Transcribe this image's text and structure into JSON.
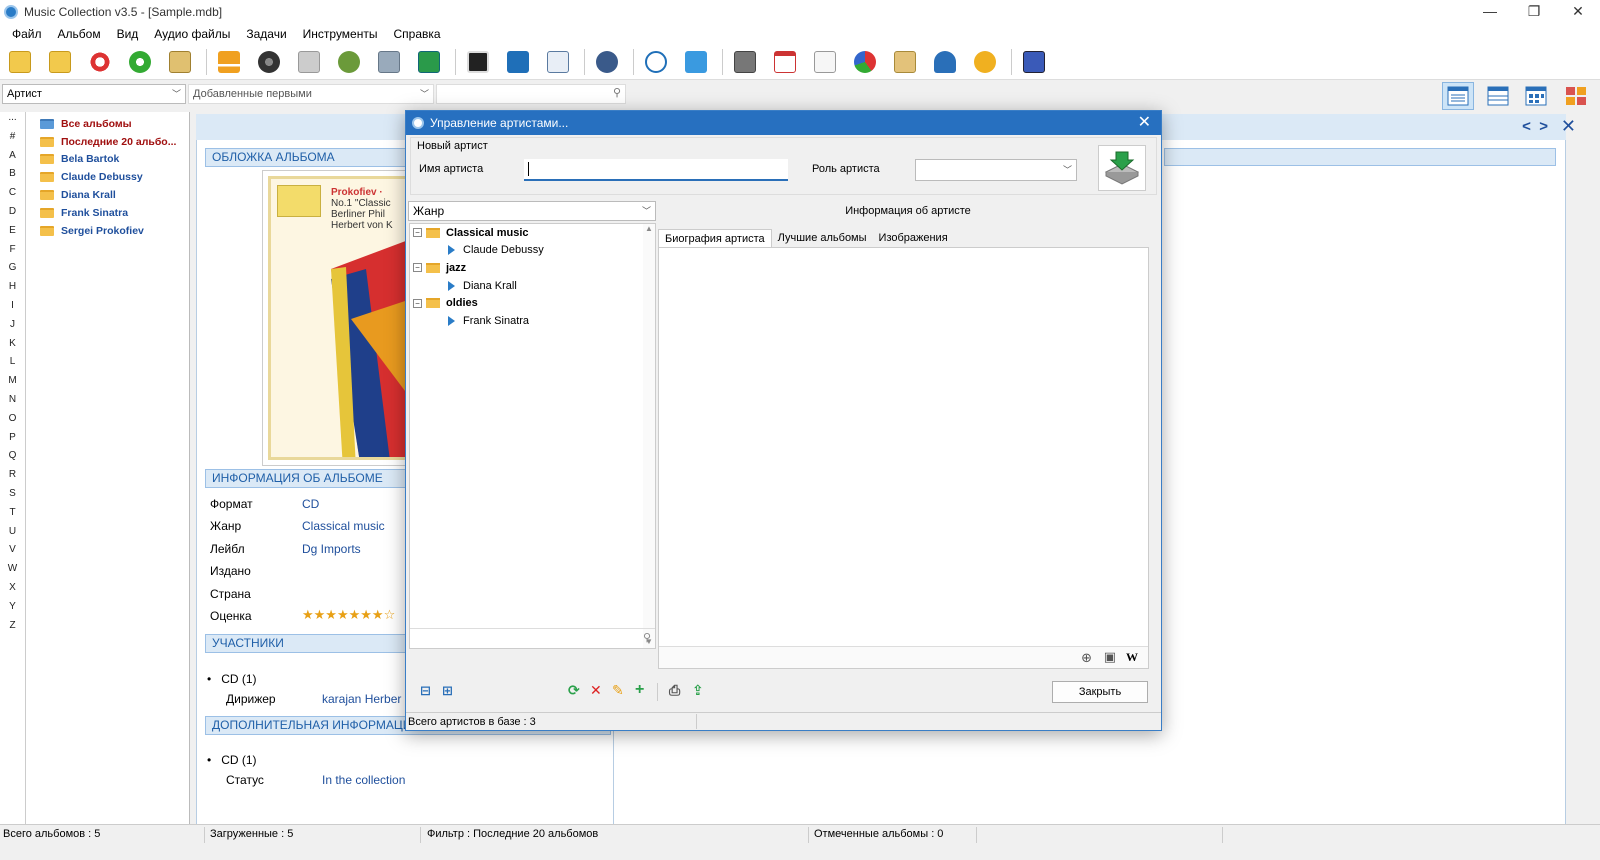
{
  "window": {
    "title": "Music Collection v3.5 - [Sample.mdb]",
    "minimize": "—",
    "restore": "❐",
    "close": "✕"
  },
  "menu": [
    "Файл",
    "Альбом",
    "Вид",
    "Аудио файлы",
    "Задачи",
    "Инструменты",
    "Справка"
  ],
  "filter": {
    "group_by": "Артист",
    "sort_by": "Добавленные первыми",
    "search_value": ""
  },
  "alphabet": [
    "...",
    "#",
    "A",
    "B",
    "C",
    "D",
    "E",
    "F",
    "G",
    "H",
    "I",
    "J",
    "K",
    "L",
    "M",
    "N",
    "O",
    "P",
    "Q",
    "R",
    "S",
    "T",
    "U",
    "V",
    "W",
    "X",
    "Y",
    "Z"
  ],
  "tree": {
    "items": [
      {
        "label": "Все альбомы"
      },
      {
        "label": "Последние 20 альбо..."
      },
      {
        "label": "Bela Bartok"
      },
      {
        "label": "Claude Debussy"
      },
      {
        "label": "Diana Krall"
      },
      {
        "label": "Frank Sinatra"
      },
      {
        "label": "Sergei Prokofiev"
      }
    ]
  },
  "album": {
    "cover_heading": "ОБЛОЖКА АЛЬБОМА",
    "cover_text_title": "Prokofiev ·",
    "cover_text_lines": [
      "No.1 \"Classic",
      "Berliner Phil",
      "Herbert von K"
    ],
    "info_heading": "ИНФОРМАЦИЯ ОБ АЛЬБОМЕ",
    "info": [
      {
        "label": "Формат",
        "value": "CD"
      },
      {
        "label": "Жанр",
        "value": "Classical music"
      },
      {
        "label": "Лейбл",
        "value": "Dg Imports"
      },
      {
        "label": "Издано",
        "value": ""
      },
      {
        "label": "Страна",
        "value": ""
      },
      {
        "label": "Оценка",
        "value": "★★★★★★★☆"
      }
    ],
    "participants_heading": "УЧАСТНИКИ",
    "participants_group": "CD (1)",
    "participants_role": "Дирижер",
    "participants_name": "karajan Herber",
    "extra_heading": "ДОПОЛНИТЕЛЬНАЯ ИНФОРМАЦИЯ",
    "extra_group": "CD (1)",
    "extra_label": "Статус",
    "extra_value": "In the collection"
  },
  "dialog": {
    "title": "Управление артистами...",
    "new_artist_label": "Новый артист",
    "artist_name_label": "Имя артиста",
    "artist_name_value": "",
    "artist_role_label": "Роль артиста",
    "artist_role_value": "",
    "genre_combo": "Жанр",
    "info_title": "Информация об артисте",
    "tabs": [
      "Биография артиста",
      "Лучшие альбомы",
      "Изображения"
    ],
    "genres": [
      {
        "name": "Classical music",
        "artists": [
          "Claude Debussy"
        ]
      },
      {
        "name": "jazz",
        "artists": [
          "Diana Krall"
        ]
      },
      {
        "name": "oldies",
        "artists": [
          "Frank Sinatra"
        ]
      }
    ],
    "close_button": "Закрыть",
    "status": "Всего артистов в базе : 3"
  },
  "status": {
    "total": "Всего альбомов : 5",
    "loaded": "Загруженные : 5",
    "filter": "Фильтр : Последние 20 альбомов",
    "marked": "Отмеченные альбомы : 0"
  },
  "colors": {
    "accent": "#2770c0",
    "link": "#1f4f9c",
    "special": "#a01010",
    "section_bg": "#dbe9f6"
  }
}
